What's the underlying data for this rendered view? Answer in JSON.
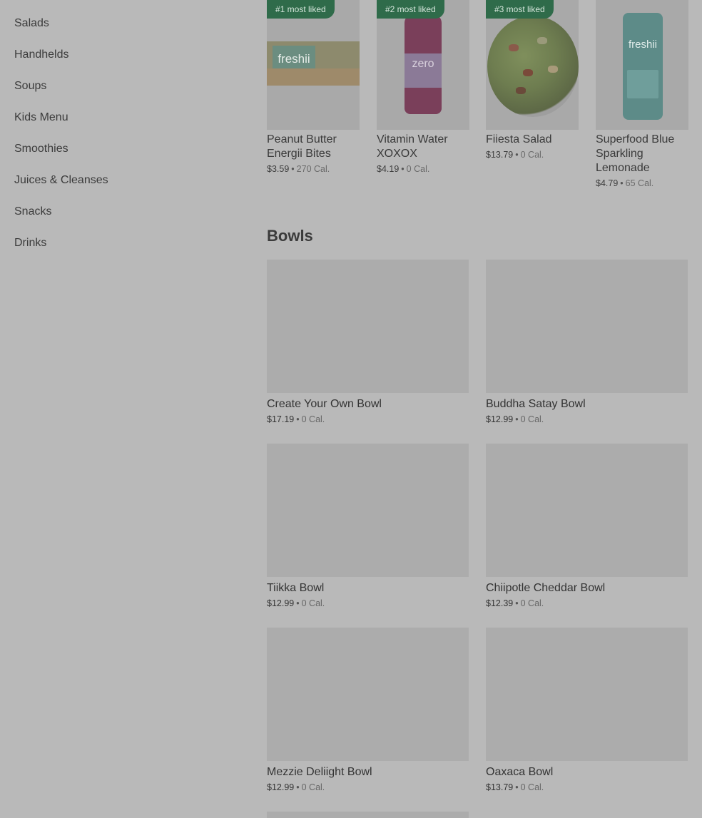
{
  "sidebar": {
    "items": [
      {
        "label": "Salads"
      },
      {
        "label": "Handhelds"
      },
      {
        "label": "Soups"
      },
      {
        "label": "Kids Menu"
      },
      {
        "label": "Smoothies"
      },
      {
        "label": "Juices & Cleanses"
      },
      {
        "label": "Snacks"
      },
      {
        "label": "Drinks"
      }
    ]
  },
  "popular": [
    {
      "badge": "#1 most liked",
      "name": "Peanut Butter Energii Bites",
      "price": "$3.59",
      "cal": "270 Cal.",
      "art_brand": "freshii"
    },
    {
      "badge": "#2 most liked",
      "name": "Vitamin Water XOXOX",
      "price": "$4.19",
      "cal": "0 Cal.",
      "art_brand": "zero"
    },
    {
      "badge": "#3 most liked",
      "name": "Fiiesta Salad",
      "price": "$13.79",
      "cal": "0 Cal."
    },
    {
      "badge": "",
      "name": "Superfood Blue Sparkling Lemonade",
      "price": "$4.79",
      "cal": "65 Cal.",
      "art_brand": "freshii"
    }
  ],
  "bowls_section": {
    "title": "Bowls",
    "items": [
      {
        "name": "Create Your Own Bowl",
        "price": "$17.19",
        "cal": "0 Cal."
      },
      {
        "name": "Buddha Satay Bowl",
        "price": "$12.99",
        "cal": "0 Cal."
      },
      {
        "name": "Tiikka Bowl",
        "price": "$12.99",
        "cal": "0 Cal."
      },
      {
        "name": "Chiipotle Cheddar Bowl",
        "price": "$12.39",
        "cal": "0 Cal."
      },
      {
        "name": "Mezzie Deliight Bowl",
        "price": "$12.99",
        "cal": "0 Cal."
      },
      {
        "name": "Oaxaca Bowl",
        "price": "$13.79",
        "cal": "0 Cal."
      }
    ]
  },
  "separator": "•",
  "colors": {
    "badge_bg": "#2f6b4a",
    "page_bg": "#b9b9b9",
    "image_placeholder": "#acacac"
  }
}
